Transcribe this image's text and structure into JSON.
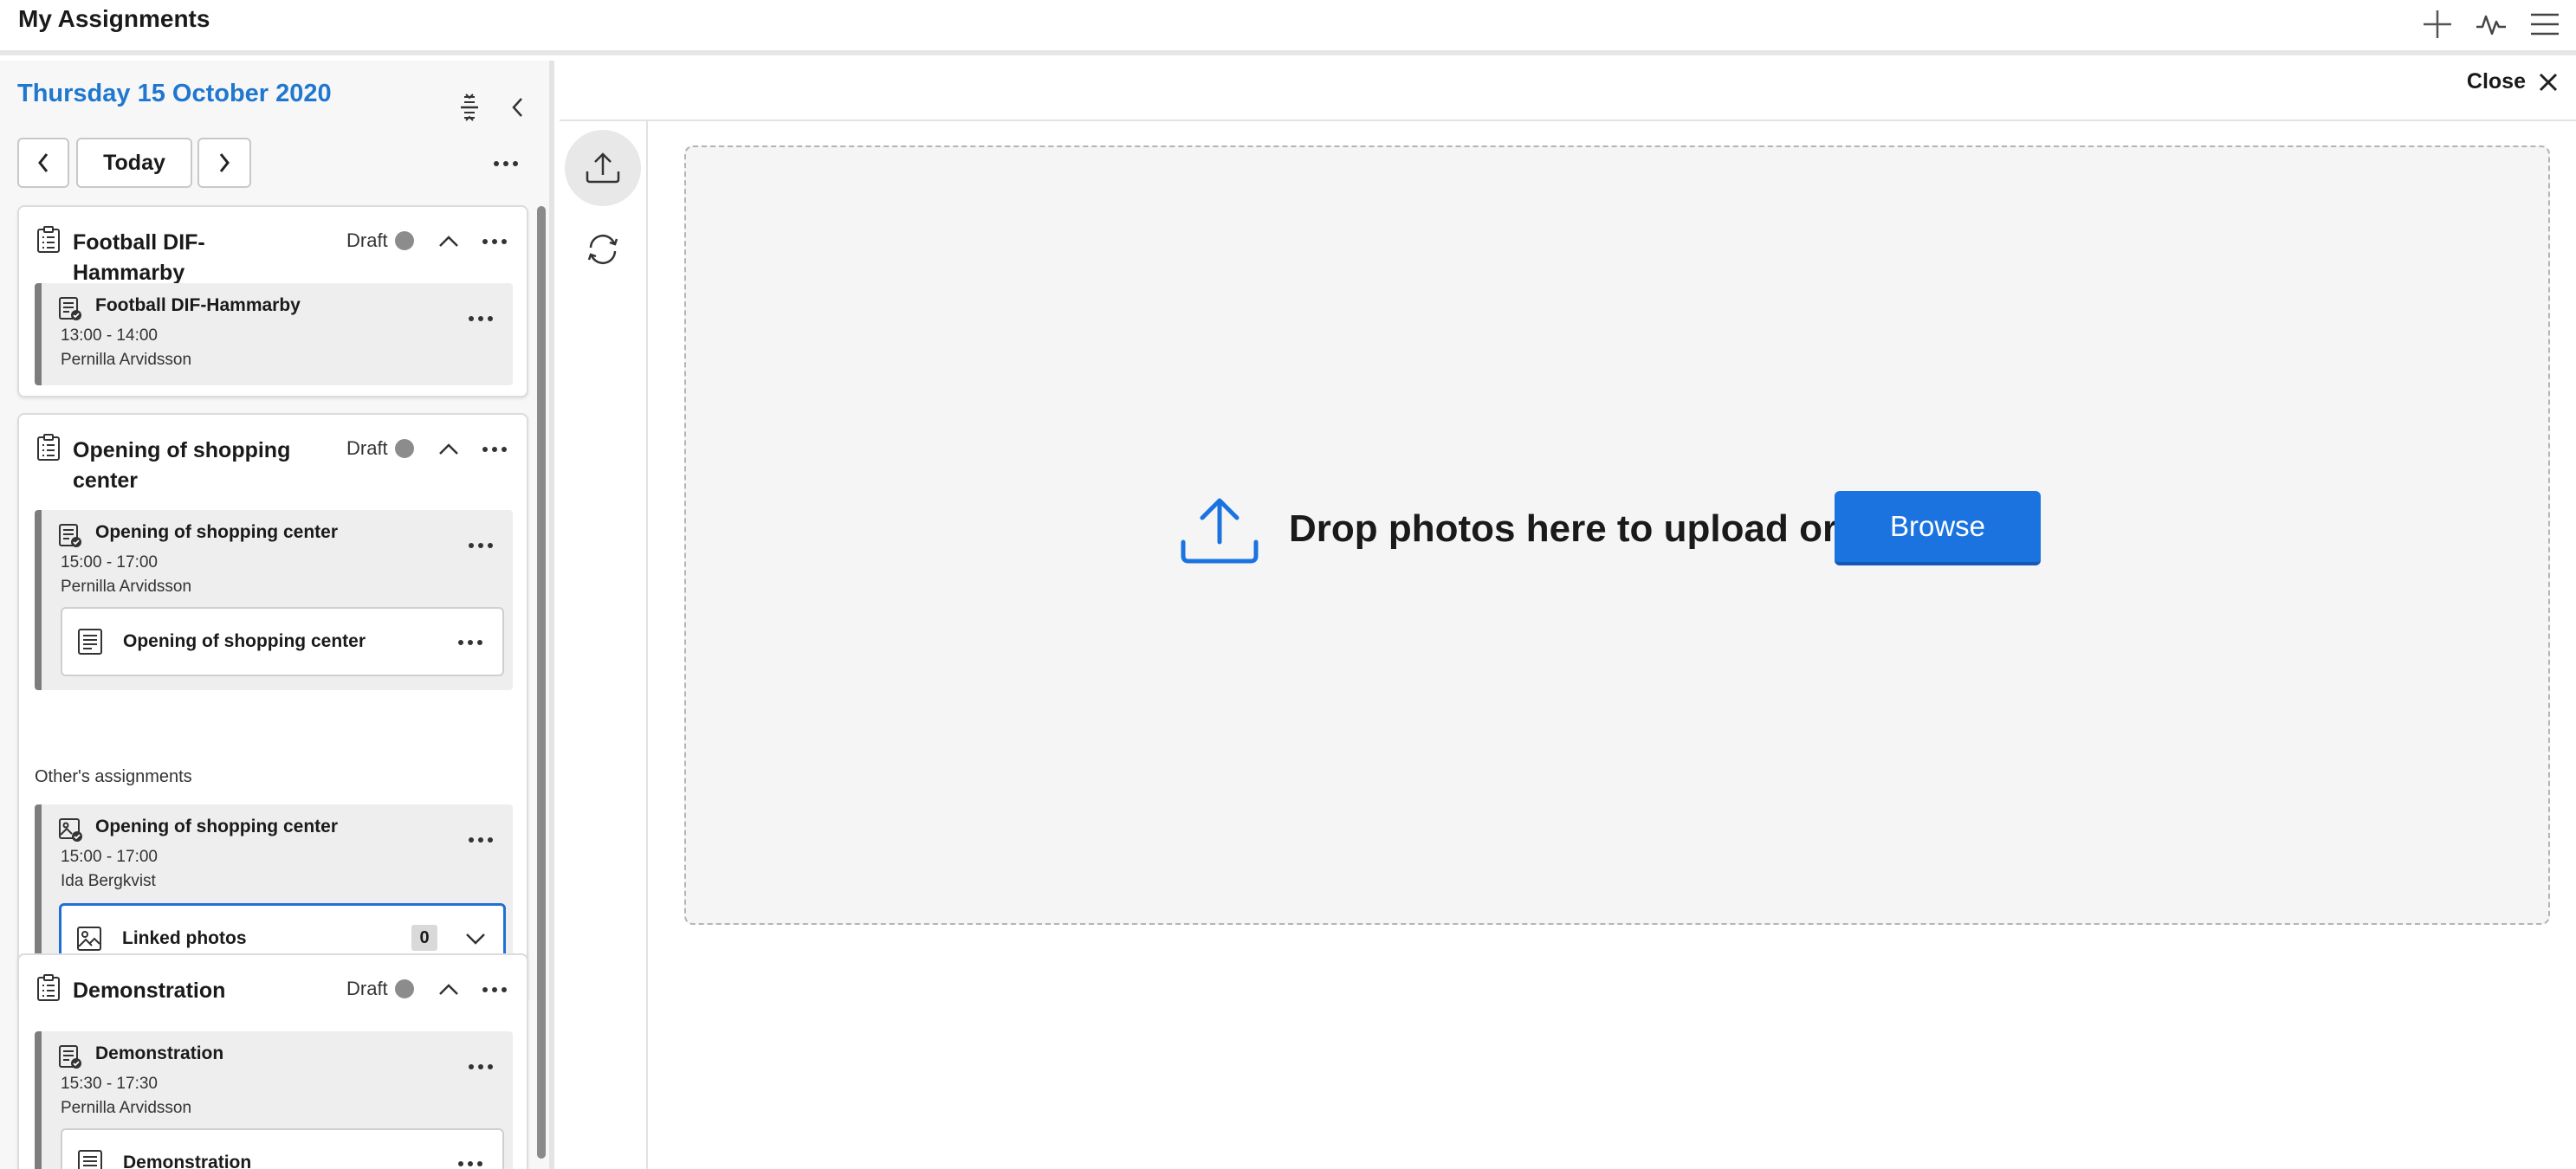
{
  "app": {
    "title": "My Assignments"
  },
  "top_icons": [
    "plus-icon",
    "activity-icon",
    "hamburger-menu-icon"
  ],
  "left": {
    "date": "Thursday 15 October 2020",
    "today_label": "Today",
    "cards": [
      {
        "title": "Football DIF-Hammarby",
        "status": "Draft",
        "sub": {
          "title": "Football DIF-Hammarby",
          "time": "13:00 - 14:00",
          "person": "Pernilla Arvidsson"
        }
      },
      {
        "title": "Opening of shopping center",
        "status": "Draft",
        "sub": {
          "title": "Opening of shopping center",
          "time": "15:00 - 17:00",
          "person": "Pernilla Arvidsson",
          "inner_title": "Opening of shopping center"
        },
        "others_label": "Other's assignments",
        "other": {
          "title": "Opening of shopping center",
          "time": "15:00 - 17:00",
          "person": "Ida Bergkvist",
          "linked_label": "Linked photos",
          "linked_count": "0"
        }
      },
      {
        "title": "Demonstration",
        "status": "Draft",
        "sub": {
          "title": "Demonstration",
          "time": "15:30 - 17:30",
          "person": "Pernilla Arvidsson",
          "inner_title": "Demonstration"
        }
      }
    ]
  },
  "right": {
    "close_label": "Close",
    "drop_text": "Drop photos here to upload or",
    "browse_label": "Browse"
  },
  "colors": {
    "accent": "#1f77d0",
    "button": "#1b73e0",
    "draft_dot": "#8c8c8c"
  }
}
